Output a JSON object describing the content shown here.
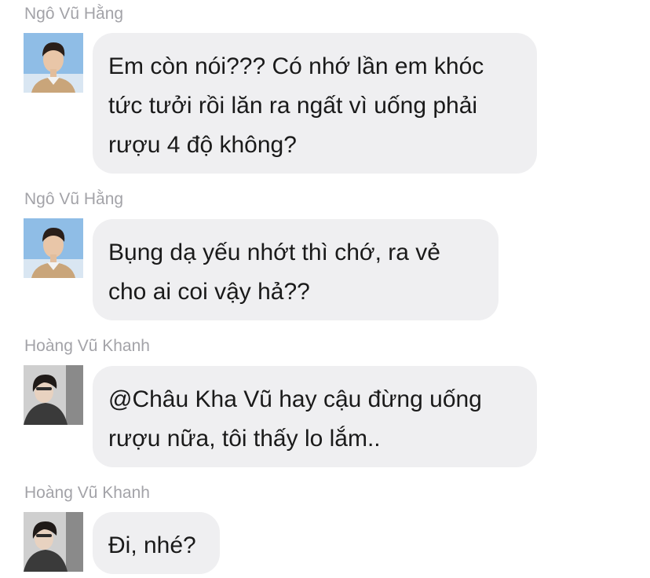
{
  "messages": [
    {
      "sender": "Ngô Vũ Hằng",
      "text": "Em còn nói??? Có nhớ lần em khóc\ntức tưởi rồi lăn ra ngất vì uống phải\nrượu 4 độ không?"
    },
    {
      "sender": "Ngô Vũ Hằng",
      "text": "Bụng dạ yếu nhớt thì chớ, ra vẻ\ncho ai coi vậy hả??"
    },
    {
      "sender": "Hoàng Vũ Khanh",
      "text": "@Châu Kha Vũ hay cậu đừng uống\nrượu nữa, tôi thấy lo lắm.."
    },
    {
      "sender": "Hoàng Vũ Khanh",
      "text": "Đi, nhé?"
    }
  ],
  "colors": {
    "bubble": "#efeff1",
    "sender_name": "#a3a3a8",
    "text": "#1a1a1a"
  }
}
